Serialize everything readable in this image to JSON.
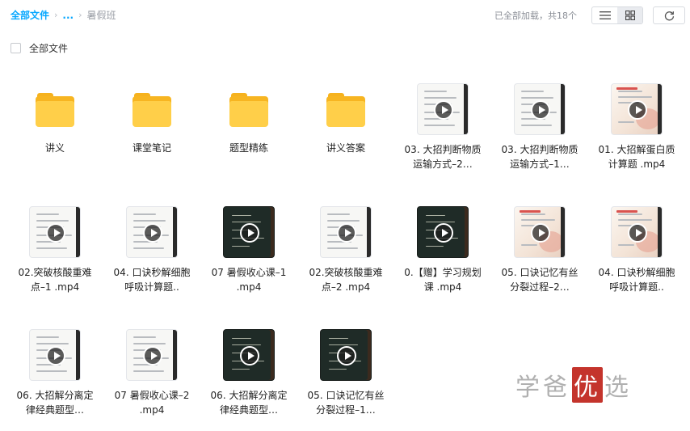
{
  "breadcrumb": {
    "root": "全部文件",
    "ellipsis": "...",
    "current": "暑假班"
  },
  "status_text": "已全部加载，共18个",
  "toolbar": {
    "list_view_icon": "list-icon",
    "grid_view_icon": "grid-icon",
    "refresh_icon": "refresh-icon",
    "active_view": "grid"
  },
  "select_all_label": "全部文件",
  "files": [
    {
      "name": "讲义",
      "type": "folder"
    },
    {
      "name": "课堂笔记",
      "type": "folder"
    },
    {
      "name": "题型精练",
      "type": "folder"
    },
    {
      "name": "讲义答案",
      "type": "folder"
    },
    {
      "name": "03. 大招判断物质运输方式–2…",
      "type": "video",
      "thumb": "light"
    },
    {
      "name": "03. 大招判断物质运输方式–1…",
      "type": "video",
      "thumb": "light"
    },
    {
      "name": "01. 大招解蛋白质计算题 .mp4",
      "type": "video",
      "thumb": "warm"
    },
    {
      "name": "02.突破核酸重难点–1 .mp4",
      "type": "video",
      "thumb": "light"
    },
    {
      "name": "04. 口诀秒解细胞呼吸计算题..",
      "type": "video",
      "thumb": "light"
    },
    {
      "name": "07 暑假收心课–1 .mp4",
      "type": "video",
      "thumb": "dark"
    },
    {
      "name": "02.突破核酸重难点–2 .mp4",
      "type": "video",
      "thumb": "light"
    },
    {
      "name": "0.【赠】学习规划课 .mp4",
      "type": "video",
      "thumb": "dark"
    },
    {
      "name": "05. 口诀记忆有丝分裂过程–2…",
      "type": "video",
      "thumb": "warm"
    },
    {
      "name": "04. 口诀秒解细胞呼吸计算题..",
      "type": "video",
      "thumb": "warm"
    },
    {
      "name": "06. 大招解分离定律经典题型…",
      "type": "video",
      "thumb": "light"
    },
    {
      "name": "07 暑假收心课–2 .mp4",
      "type": "video",
      "thumb": "light"
    },
    {
      "name": "06. 大招解分离定律经典题型…",
      "type": "video",
      "thumb": "dark"
    },
    {
      "name": "05. 口诀记忆有丝分裂过程–1…",
      "type": "video",
      "thumb": "dark"
    }
  ],
  "watermark": {
    "part1": "学爸",
    "highlight": "优",
    "part2": "选"
  },
  "colors": {
    "accent": "#06a7ff",
    "folder": "#ffcf49",
    "watermark_red": "#c4342c"
  }
}
